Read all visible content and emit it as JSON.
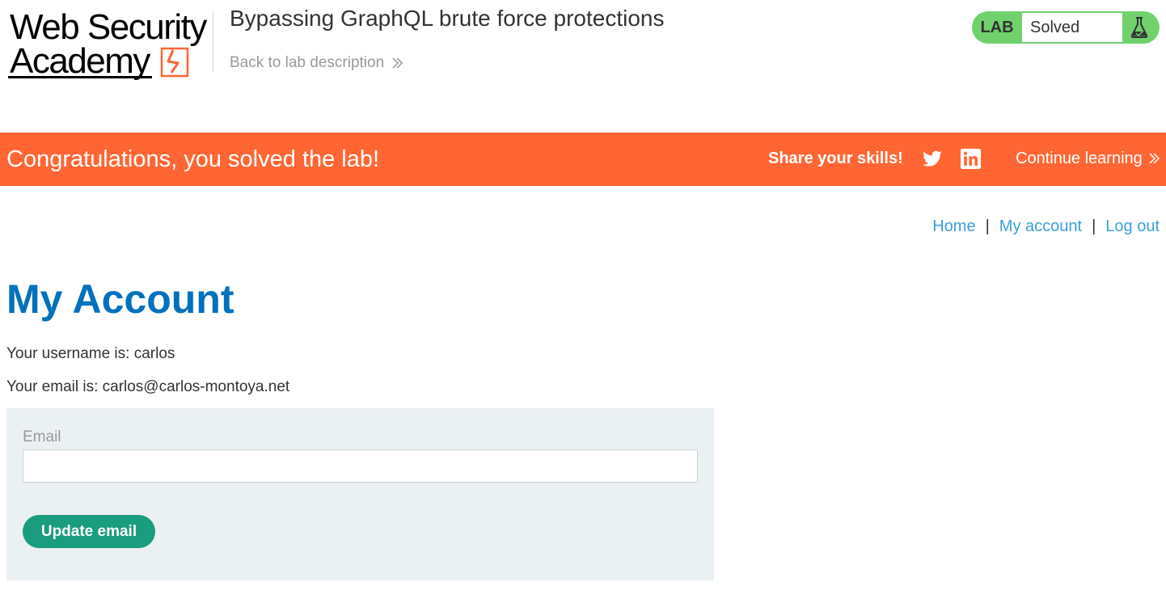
{
  "header": {
    "logo_line1": "Web Security",
    "logo_line2": "Academy",
    "lab_title": "Bypassing GraphQL brute force protections",
    "back_link": "Back to lab description",
    "status_tag": "LAB",
    "status_value": "Solved"
  },
  "banner": {
    "message": "Congratulations, you solved the lab!",
    "share_label": "Share your skills!",
    "continue_label": "Continue learning",
    "icons": [
      "twitter-icon",
      "linkedin-icon"
    ]
  },
  "nav": {
    "home": "Home",
    "separator": "|",
    "my_account": "My account",
    "log_out": "Log out"
  },
  "main": {
    "heading": "My Account",
    "username_line": "Your username is: carlos",
    "email_line": "Your email is: carlos@carlos-montoya.net",
    "form": {
      "email_label": "Email",
      "email_value": "",
      "submit_label": "Update email"
    }
  },
  "colors": {
    "banner": "#ff6633",
    "heading": "#0071bc",
    "link": "#3c9fd6",
    "status_green": "#70d16d",
    "button": "#1a9c7e",
    "form_bg": "#ebf0f2"
  }
}
